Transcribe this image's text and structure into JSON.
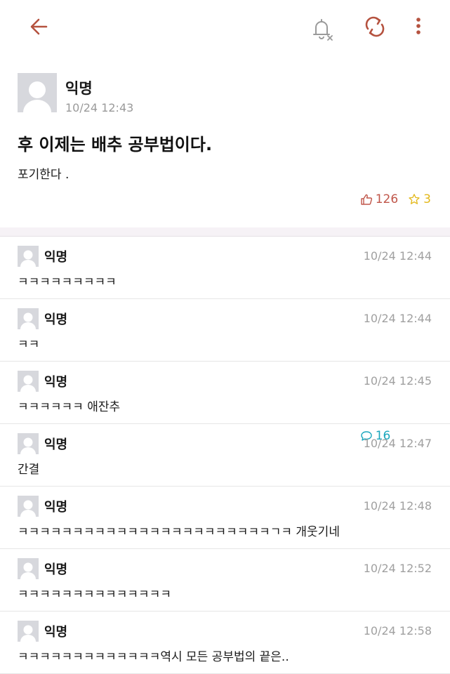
{
  "post": {
    "author": "익명",
    "time": "10/24 12:43",
    "title": "후 이제는 배추 공부법이다.",
    "body": "포기한다 .",
    "likes": "126",
    "comments": "16",
    "scraps": "3"
  },
  "icons": {
    "back": "arrow-left-icon",
    "bell": "bell-off-icon",
    "refresh": "refresh-icon",
    "more": "more-vertical-icon"
  },
  "colors": {
    "accent": "#b5523f",
    "like": "#c0564a",
    "comment": "#1aa7bd",
    "scrap": "#e3b81a"
  },
  "comments": [
    {
      "author": "익명",
      "time": "10/24 12:44",
      "text": "ㅋㅋㅋㅋㅋㅋㅋㅋㅋ"
    },
    {
      "author": "익명",
      "time": "10/24 12:44",
      "text": "ㅋㅋ"
    },
    {
      "author": "익명",
      "time": "10/24 12:45",
      "text": "ㅋㅋㅋㅋㅋㅋ 애잔추"
    },
    {
      "author": "익명",
      "time": "10/24 12:47",
      "text": "간결"
    },
    {
      "author": "익명",
      "time": "10/24 12:48",
      "text": "ㅋㅋㅋㅋㅋㅋㅋㅋㅋㅋㅋㅋㅋㅋㅋㅋㅋㅋㅋㅋㅋㅋㅋㄱㅋ 개웃기네"
    },
    {
      "author": "익명",
      "time": "10/24 12:52",
      "text": "ㅋㅋㅋㅋㅋㅋㅋㅋㅋㅋㅋㅋㅋㅋ"
    },
    {
      "author": "익명",
      "time": "10/24 12:58",
      "text": "ㅋㅋㅋㅋㅋㅋㅋㅋㅋㅋㅋㅋㅋ역시 모든 공부법의 끝은.."
    }
  ]
}
